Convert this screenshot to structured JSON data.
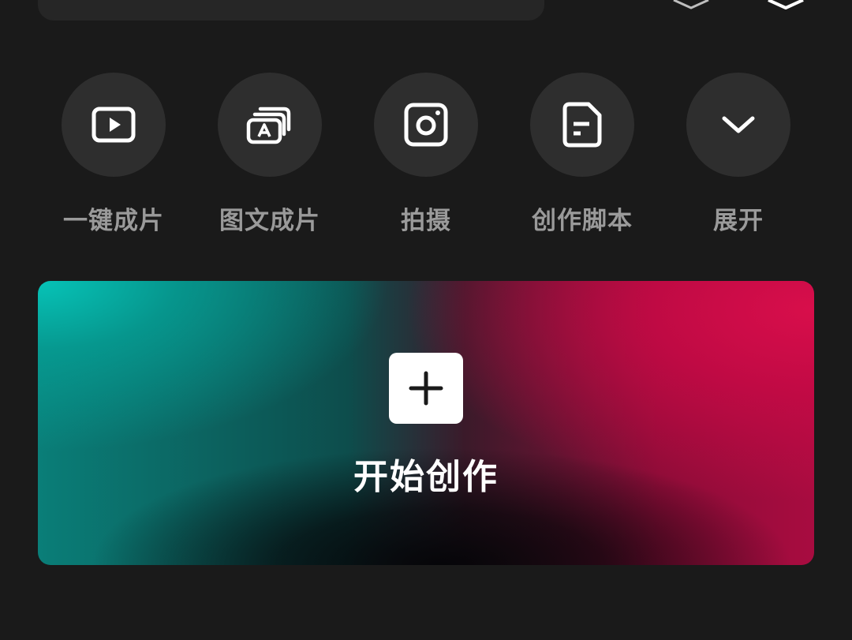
{
  "header": {
    "icons": [
      "layers-icon",
      "cube-icon"
    ]
  },
  "quick_actions": [
    {
      "id": "one-click",
      "label": "一键成片",
      "icon": "video-play-icon"
    },
    {
      "id": "text-to-video",
      "label": "图文成片",
      "icon": "text-image-icon"
    },
    {
      "id": "shoot",
      "label": "拍摄",
      "icon": "camera-icon"
    },
    {
      "id": "script",
      "label": "创作脚本",
      "icon": "document-icon"
    },
    {
      "id": "expand",
      "label": "展开",
      "icon": "chevron-down-icon"
    }
  ],
  "create_card": {
    "label": "开始创作",
    "icon": "plus-icon",
    "colors": {
      "left": "#06c3b7",
      "right": "#d80e4b",
      "center": "#050508"
    }
  },
  "colors": {
    "background": "#1a1a1a",
    "circle": "#2e2e2e",
    "label": "#9a9a9a"
  }
}
